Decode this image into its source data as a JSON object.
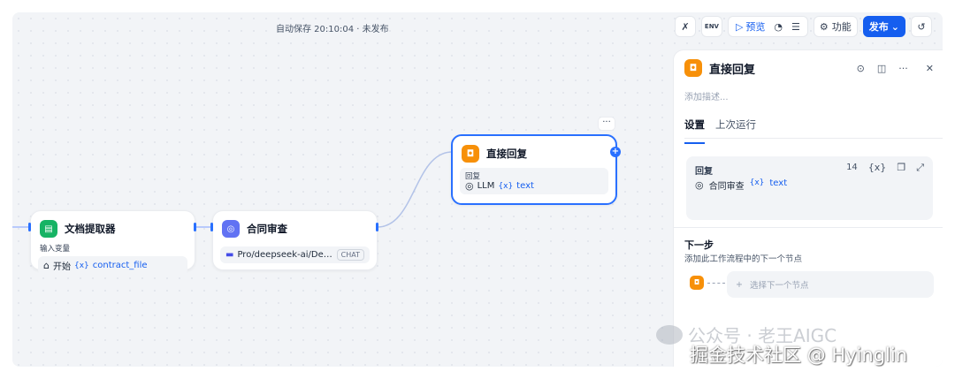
{
  "status": {
    "autosave": "自动保存 20:10:04 · 未发布"
  },
  "toolbar": {
    "preview_label": "预览",
    "features_label": "功能",
    "publish_label": "发布",
    "env_label": "ENV"
  },
  "nodes": {
    "doc_extractor": {
      "title": "文档提取器",
      "input_label": "输入变量",
      "source": "开始",
      "variable": "contract_file"
    },
    "contract_review": {
      "title": "合同审查",
      "model": "Pro/deepseek-ai/Dee...",
      "badge": "CHAT"
    },
    "direct_reply": {
      "title": "直接回复",
      "field_label": "回复",
      "source": "LLM",
      "variable": "text",
      "more": "···"
    }
  },
  "panel": {
    "title": "直接回复",
    "desc_placeholder": "添加描述...",
    "tabs": [
      "设置",
      "上次运行"
    ],
    "reply_label": "回复",
    "reply_count": "14",
    "reply_source": "合同审查",
    "reply_variable": "text",
    "next_title": "下一步",
    "next_desc": "添加此工作流程中的下一个节点",
    "next_select_placeholder": "选择下一个节点"
  },
  "watermarks": {
    "wechat": "公众号 · 老王AIGC",
    "juejin": "掘金技术社区 @ Hyinglin"
  },
  "colors": {
    "accent": "#155eef",
    "node_green": "#16b364",
    "node_purple": "#6172f3",
    "node_orange": "#f79009"
  }
}
